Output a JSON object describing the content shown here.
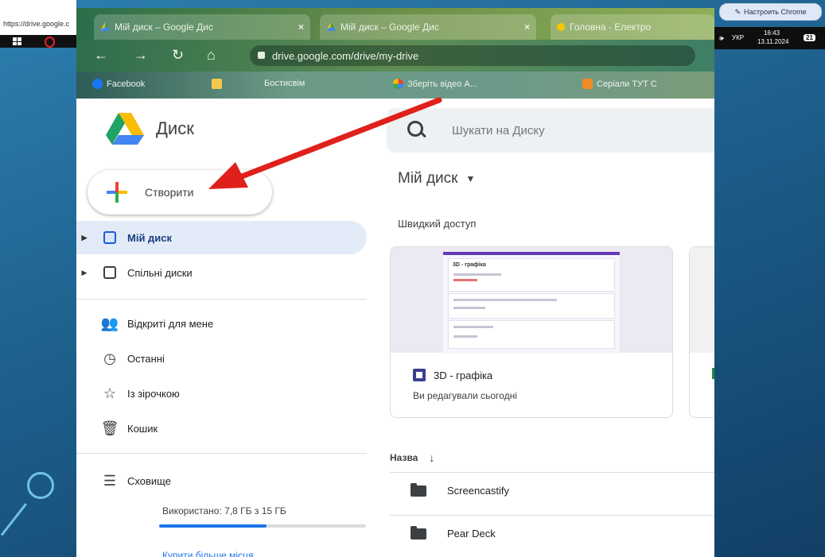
{
  "browser_strip": {
    "url_partial": "https://drive.google.c"
  },
  "chrome_button": {
    "label": "Настроить Chrome"
  },
  "tray": {
    "lang": "УКР",
    "time": "16:43",
    "date": "13.11.2024",
    "notifications": "21"
  },
  "tabs": [
    {
      "title": "Мій диск – Google Дис",
      "close": "×"
    },
    {
      "title": "Мій диск – Google Дис",
      "close": "×"
    },
    {
      "title": "Головна - Електро"
    }
  ],
  "address_bar": {
    "url": "drive.google.com/drive/my-drive"
  },
  "bookmarks": [
    "Facebook",
    "",
    "Бостисвім",
    "Зберіть відео А...",
    "Серіали ТУТ С"
  ],
  "app": {
    "name": "Диск"
  },
  "search": {
    "placeholder": "Шукати на Диску"
  },
  "create_button": {
    "label": "Створити"
  },
  "sidebar": {
    "items": [
      {
        "label": "Мій диск",
        "active": true
      },
      {
        "label": "Спільні диски"
      },
      {
        "label": "Відкриті для мене"
      },
      {
        "label": "Останні"
      },
      {
        "label": "Із зірочкою"
      },
      {
        "label": "Кошик"
      }
    ],
    "storage": {
      "label": "Сховище",
      "usage": "Використано: 7,8 ГБ з 15 ГБ",
      "fraction": 0.52,
      "more": "Купити більше місця"
    }
  },
  "main": {
    "title": "Мій диск",
    "quick_access": "Швидкий доступ",
    "card": {
      "name": "3D - графіка",
      "sub": "Ви редагували сьогодні",
      "doc_title": "3D - графіка"
    },
    "list_header": "Назва",
    "files": [
      "Screencastify",
      "Pear Deck"
    ]
  },
  "colors": {
    "accent": "#1a73e8",
    "arrow": "#e0201b",
    "background": "#1d5f8c"
  }
}
